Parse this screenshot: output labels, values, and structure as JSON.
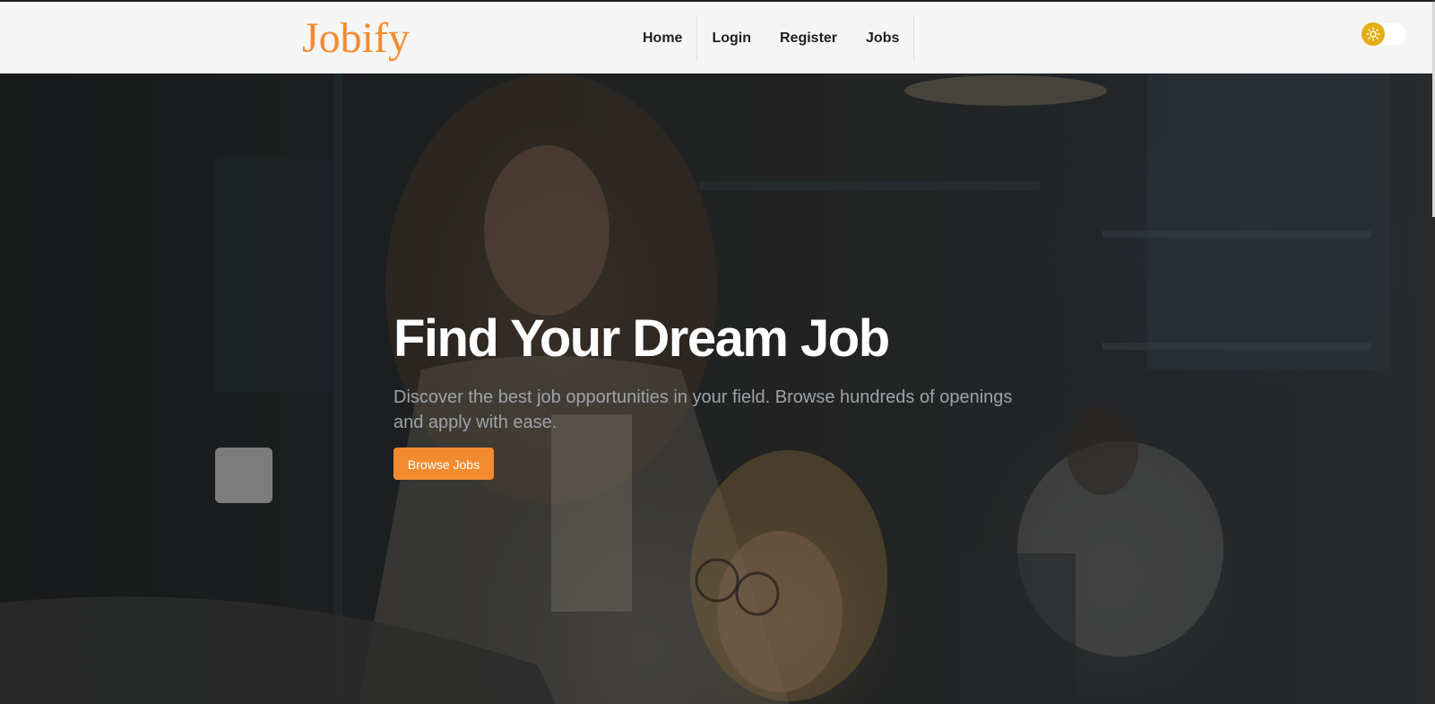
{
  "navbar": {
    "logo": "Jobify",
    "links": [
      {
        "label": "Home"
      },
      {
        "label": "Login"
      },
      {
        "label": "Register"
      },
      {
        "label": "Jobs"
      }
    ],
    "theme_toggle": {
      "icon": "sun-icon",
      "mode": "light"
    }
  },
  "hero": {
    "title": "Find Your Dream Job",
    "subtitle": "Discover the best job opportunities in your field. Browse hundreds of openings and apply with ease.",
    "cta_label": "Browse Jobs",
    "background_image": "office-photo-two-women-at-laptop"
  },
  "colors": {
    "accent": "#f28b2f",
    "navbar_bg": "#f5f5f5",
    "toggle_knob": "#e6ad12",
    "hero_title": "#ffffff",
    "hero_subtitle": "#9ea3a8"
  }
}
